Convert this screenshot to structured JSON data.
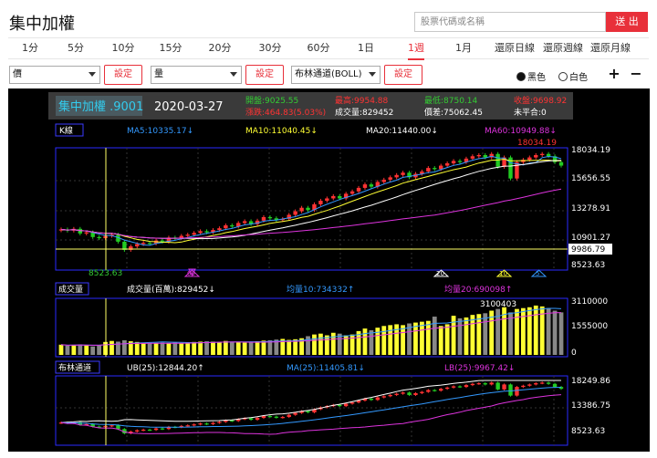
{
  "app": {
    "title": "集中加權",
    "exit_label": "送 出",
    "search_placeholder": "股票代碼或名稱"
  },
  "tabs": [
    "1分",
    "5分",
    "10分",
    "15分",
    "20分",
    "30分",
    "60分",
    "1日",
    "1週",
    "1月",
    "還原日線",
    "還原週線",
    "還原月線"
  ],
  "active_tab": "1週",
  "controls": {
    "price_select": "價",
    "volume_select": "量",
    "indicator_select": "布林通道(BOLL)",
    "settings_label": "設定",
    "theme_black": "黑色",
    "theme_white": "白色",
    "theme_selected": "黑色",
    "zoom_in": "+",
    "zoom_out": "−"
  },
  "header": {
    "name": "集中加權 .9001",
    "date": "2020-03-27",
    "open": "開盤:9025.55",
    "high": "最高:9954.88",
    "low": "最低:8750.14",
    "close": "收盤:9698.92",
    "change": "漲跌:464.83(5.03%)",
    "volume": "成交量:829452",
    "spread": "價差:75062.45",
    "unchanged": "未平合:0"
  },
  "kline": {
    "label": "K線",
    "ma5": "MA5:10335.17↓",
    "ma10": "MA10:11040.45↓",
    "ma20": "MA20:11440.00↓",
    "ma60": "MA60:10949.88↓",
    "price_ticks": [
      "18034.19",
      "15656.55",
      "13278.91",
      "10901.27",
      "9986.79",
      "8523.63"
    ],
    "max_label": "18034.19",
    "min_label": "8523.63",
    "markers": [
      "60",
      "20",
      "10",
      "5"
    ]
  },
  "volume": {
    "label": "成交量",
    "value": "成交量(百萬):829452↓",
    "ma10": "均量10:734332↑",
    "ma20": "均量20:690098↑",
    "ticks": [
      "3110000",
      "1555000",
      "0"
    ],
    "max_label": "3100403"
  },
  "boll": {
    "label": "布林通道",
    "ub": "UB(25):12844.20↑",
    "ma": "MA(25):11405.81↓",
    "lb": "LB(25):9967.42↓",
    "ticks": [
      "18249.86",
      "13386.75",
      "8523.63"
    ]
  },
  "chart_data": {
    "type": "candlestick",
    "x": [
      1,
      2,
      3,
      4,
      5,
      6,
      7,
      8,
      9,
      10,
      11,
      12,
      13,
      14,
      15,
      16,
      17,
      18,
      19,
      20,
      21,
      22,
      23,
      24,
      25,
      26,
      27,
      28,
      29,
      30,
      31,
      32,
      33,
      34,
      35,
      36,
      37,
      38,
      39,
      40,
      41,
      42,
      43,
      44,
      45,
      46,
      47,
      48,
      49,
      50,
      51,
      52,
      53,
      54,
      55,
      56,
      57,
      58,
      59,
      60,
      61,
      62,
      63,
      64,
      65,
      66,
      67,
      68,
      69,
      70,
      71,
      72,
      73,
      74,
      75,
      76,
      77,
      78,
      79,
      80
    ],
    "close": [
      11450,
      11350,
      11500,
      11100,
      11200,
      10800,
      10700,
      10900,
      11000,
      10400,
      9700,
      10000,
      10200,
      10300,
      10250,
      10500,
      10400,
      10750,
      10700,
      10900,
      11000,
      11150,
      11300,
      11200,
      11400,
      11550,
      11800,
      11700,
      12000,
      12150,
      11900,
      12200,
      12500,
      12400,
      12250,
      12350,
      12700,
      13000,
      13300,
      13100,
      13600,
      13900,
      14100,
      14300,
      14100,
      14500,
      14700,
      15000,
      15300,
      15100,
      15500,
      15700,
      15900,
      16100,
      16300,
      15900,
      16200,
      16400,
      16700,
      16600,
      16900,
      17100,
      17300,
      17200,
      17500,
      17700,
      17800,
      17600,
      17900,
      16800,
      17600,
      15800,
      17200,
      17400,
      17600,
      17800,
      17900,
      17700,
      17200,
      16900
    ],
    "volume": [
      600000,
      540000,
      580000,
      620000,
      560000,
      500000,
      590000,
      760000,
      820000,
      780000,
      860000,
      800000,
      760000,
      720000,
      700000,
      680000,
      720000,
      690000,
      740000,
      700000,
      720000,
      760000,
      780000,
      800000,
      780000,
      760000,
      820000,
      780000,
      740000,
      720000,
      760000,
      800000,
      840000,
      860000,
      900000,
      940000,
      880000,
      920000,
      980000,
      1100000,
      1200000,
      1250000,
      1150000,
      1300000,
      1250000,
      1150000,
      1200000,
      1400000,
      1550000,
      1450000,
      1600000,
      1700000,
      1750000,
      1800000,
      1750000,
      1850000,
      1900000,
      1950000,
      2000000,
      2250000,
      1700000,
      1800000,
      2300000,
      2150000,
      2200000,
      2350000,
      2400000,
      2450000,
      2600000,
      2700000,
      2800000,
      2500000,
      2700000,
      2750000,
      2800000,
      2900000,
      2850000,
      2750000,
      2600000,
      2500000
    ]
  },
  "colors": {
    "up": "#ff3333",
    "down": "#22cc22",
    "volume_up": "#ffff33",
    "volume_down": "#888888",
    "ma5": "#3399ff",
    "ma10": "#ffff33",
    "ma20": "#ffffff",
    "ma60": "#dd33dd",
    "accent": "#e8303a"
  }
}
